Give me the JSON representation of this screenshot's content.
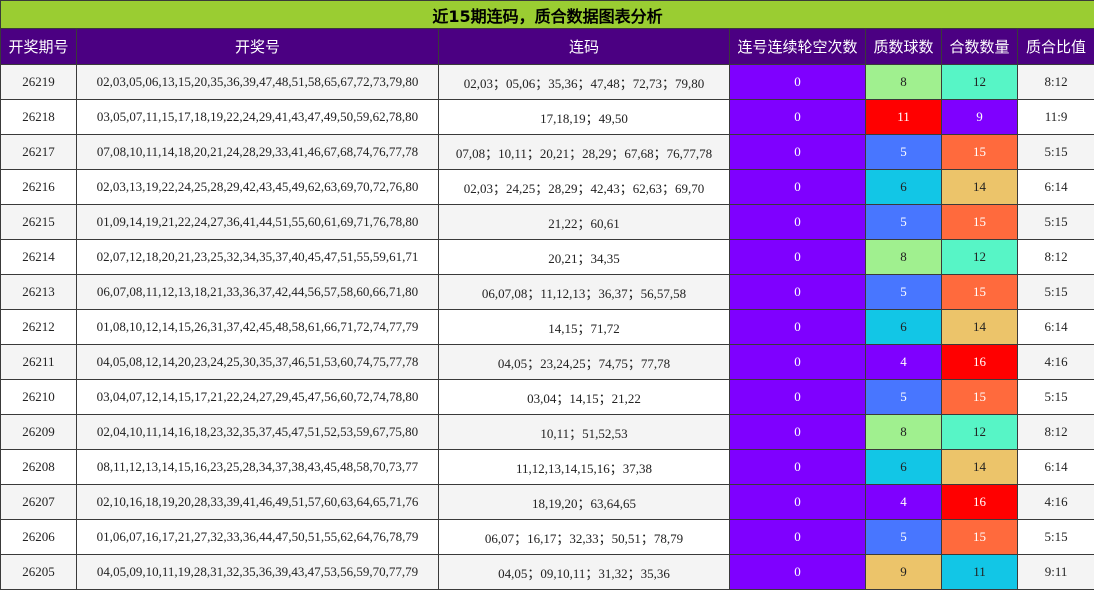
{
  "title": "近15期连码，质合数据图表分析",
  "headers": [
    "开奖期号",
    "开奖号",
    "连码",
    "连号连续轮空次数",
    "质数球数",
    "合数数量",
    "质合比值"
  ],
  "colors": {
    "title_bg": "#9acd32",
    "header_bg": "#4b0082",
    "gap_bg": "#7f00ff",
    "limegreen": "#a0f08f",
    "aquamarine": "#57f5c6",
    "red": "#ff0000",
    "violet": "#7f00ff",
    "royal": "#4876ff",
    "orange": "#ff6a3d",
    "cyan": "#12c6e6",
    "tan": "#ecc46a"
  },
  "rows": [
    {
      "period": "26219",
      "numbers": "02,03,05,06,13,15,20,35,36,39,47,48,51,58,65,67,72,73,79,80",
      "lianma": "02,03；05,06；35,36；47,48；72,73；79,80",
      "gap": "0",
      "prime": "8",
      "prime_color": "limegreen",
      "composite": "12",
      "composite_color": "aquamarine",
      "ratio": "8:12"
    },
    {
      "period": "26218",
      "numbers": "03,05,07,11,15,17,18,19,22,24,29,41,43,47,49,50,59,62,78,80",
      "lianma": "17,18,19；49,50",
      "gap": "0",
      "prime": "11",
      "prime_color": "red",
      "composite": "9",
      "composite_color": "violet",
      "ratio": "11:9"
    },
    {
      "period": "26217",
      "numbers": "07,08,10,11,14,18,20,21,24,28,29,33,41,46,67,68,74,76,77,78",
      "lianma": "07,08；10,11；20,21；28,29；67,68；76,77,78",
      "gap": "0",
      "prime": "5",
      "prime_color": "royal",
      "composite": "15",
      "composite_color": "orange",
      "ratio": "5:15"
    },
    {
      "period": "26216",
      "numbers": "02,03,13,19,22,24,25,28,29,42,43,45,49,62,63,69,70,72,76,80",
      "lianma": "02,03；24,25；28,29；42,43；62,63；69,70",
      "gap": "0",
      "prime": "6",
      "prime_color": "cyan",
      "composite": "14",
      "composite_color": "tan",
      "ratio": "6:14"
    },
    {
      "period": "26215",
      "numbers": "01,09,14,19,21,22,24,27,36,41,44,51,55,60,61,69,71,76,78,80",
      "lianma": "21,22；60,61",
      "gap": "0",
      "prime": "5",
      "prime_color": "royal",
      "composite": "15",
      "composite_color": "orange",
      "ratio": "5:15"
    },
    {
      "period": "26214",
      "numbers": "02,07,12,18,20,21,23,25,32,34,35,37,40,45,47,51,55,59,61,71",
      "lianma": "20,21；34,35",
      "gap": "0",
      "prime": "8",
      "prime_color": "limegreen",
      "composite": "12",
      "composite_color": "aquamarine",
      "ratio": "8:12"
    },
    {
      "period": "26213",
      "numbers": "06,07,08,11,12,13,18,21,33,36,37,42,44,56,57,58,60,66,71,80",
      "lianma": "06,07,08；11,12,13；36,37；56,57,58",
      "gap": "0",
      "prime": "5",
      "prime_color": "royal",
      "composite": "15",
      "composite_color": "orange",
      "ratio": "5:15"
    },
    {
      "period": "26212",
      "numbers": "01,08,10,12,14,15,26,31,37,42,45,48,58,61,66,71,72,74,77,79",
      "lianma": "14,15；71,72",
      "gap": "0",
      "prime": "6",
      "prime_color": "cyan",
      "composite": "14",
      "composite_color": "tan",
      "ratio": "6:14"
    },
    {
      "period": "26211",
      "numbers": "04,05,08,12,14,20,23,24,25,30,35,37,46,51,53,60,74,75,77,78",
      "lianma": "04,05；23,24,25；74,75；77,78",
      "gap": "0",
      "prime": "4",
      "prime_color": "violet",
      "composite": "16",
      "composite_color": "red",
      "ratio": "4:16"
    },
    {
      "period": "26210",
      "numbers": "03,04,07,12,14,15,17,21,22,24,27,29,45,47,56,60,72,74,78,80",
      "lianma": "03,04；14,15；21,22",
      "gap": "0",
      "prime": "5",
      "prime_color": "royal",
      "composite": "15",
      "composite_color": "orange",
      "ratio": "5:15"
    },
    {
      "period": "26209",
      "numbers": "02,04,10,11,14,16,18,23,32,35,37,45,47,51,52,53,59,67,75,80",
      "lianma": "10,11；51,52,53",
      "gap": "0",
      "prime": "8",
      "prime_color": "limegreen",
      "composite": "12",
      "composite_color": "aquamarine",
      "ratio": "8:12"
    },
    {
      "period": "26208",
      "numbers": "08,11,12,13,14,15,16,23,25,28,34,37,38,43,45,48,58,70,73,77",
      "lianma": "11,12,13,14,15,16；37,38",
      "gap": "0",
      "prime": "6",
      "prime_color": "cyan",
      "composite": "14",
      "composite_color": "tan",
      "ratio": "6:14"
    },
    {
      "period": "26207",
      "numbers": "02,10,16,18,19,20,28,33,39,41,46,49,51,57,60,63,64,65,71,76",
      "lianma": "18,19,20；63,64,65",
      "gap": "0",
      "prime": "4",
      "prime_color": "violet",
      "composite": "16",
      "composite_color": "red",
      "ratio": "4:16"
    },
    {
      "period": "26206",
      "numbers": "01,06,07,16,17,21,27,32,33,36,44,47,50,51,55,62,64,76,78,79",
      "lianma": "06,07；16,17；32,33；50,51；78,79",
      "gap": "0",
      "prime": "5",
      "prime_color": "royal",
      "composite": "15",
      "composite_color": "orange",
      "ratio": "5:15"
    },
    {
      "period": "26205",
      "numbers": "04,05,09,10,11,19,28,31,32,35,36,39,43,47,53,56,59,70,77,79",
      "lianma": "04,05；09,10,11；31,32；35,36",
      "gap": "0",
      "prime": "9",
      "prime_color": "tan",
      "composite": "11",
      "composite_color": "cyan",
      "ratio": "9:11"
    }
  ]
}
